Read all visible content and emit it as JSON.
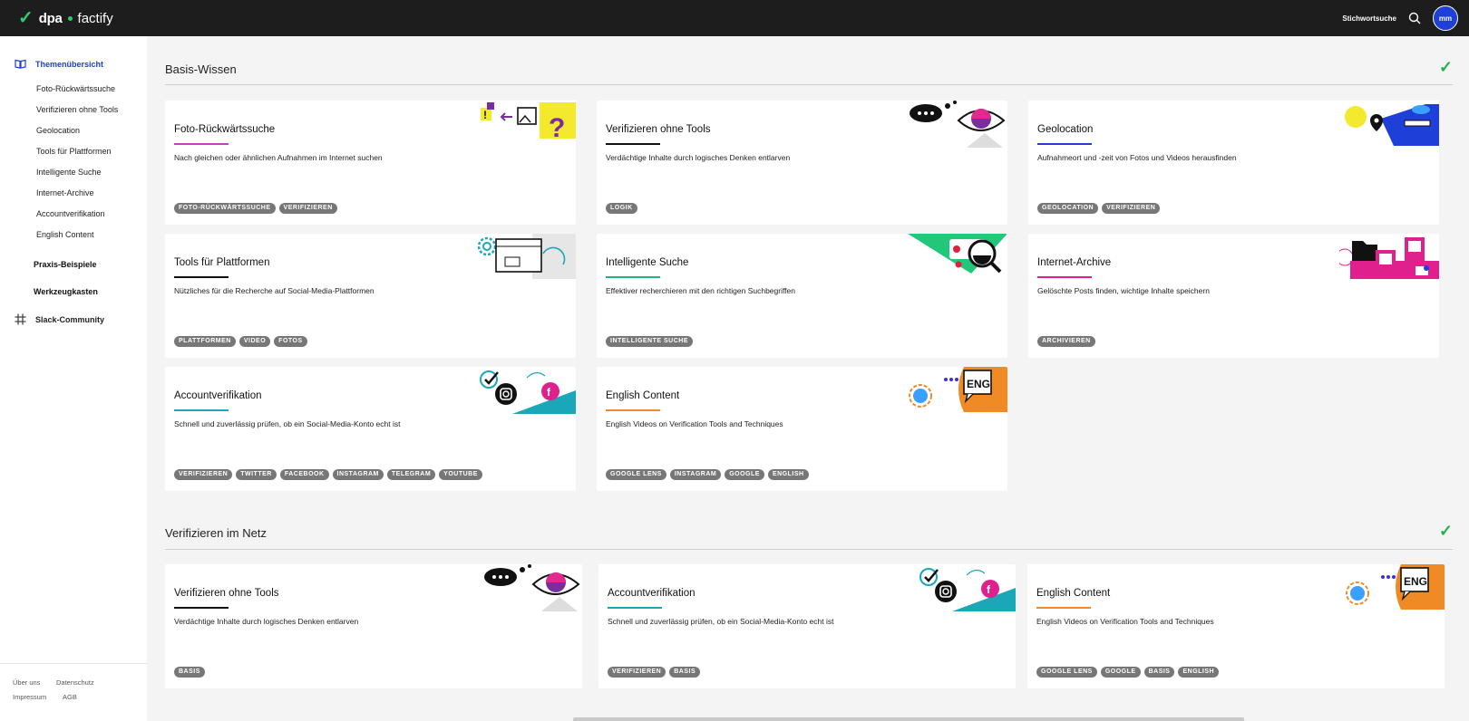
{
  "brand": {
    "name1": "dpa",
    "name2": "factify",
    "accent": "#2ecc71"
  },
  "topbar": {
    "keyword_label": "Stichwortsuche",
    "avatar_initials": "mm",
    "avatar_color": "#1e40d8"
  },
  "sidebar": {
    "items": [
      {
        "label": "Themenübersicht",
        "active": true,
        "icon": "book-icon"
      },
      {
        "label": "Praxis-Beispiele"
      },
      {
        "label": "Werkzeugkasten"
      },
      {
        "label": "Slack-Community",
        "icon": "slack-icon"
      }
    ],
    "subitems": [
      "Foto-Rückwärtssuche",
      "Verifizieren ohne Tools",
      "Geolocation",
      "Tools für Plattformen",
      "Intelligente Suche",
      "Internet-Archive",
      "Accountverifikation",
      "English Content"
    ],
    "footer": [
      "Über uns",
      "Datenschutz",
      "Impressum",
      "AGB"
    ]
  },
  "sections": [
    {
      "title": "Basis-Wissen",
      "cards": [
        {
          "title": "Foto-Rückwärtssuche",
          "desc": "Nach gleichen oder ähnlichen Aufnahmen im Internet suchen",
          "tags": [
            "FOTO-RÜCKWÄRTSSUCHE",
            "VERIFIZIEREN"
          ],
          "color": "#c040c0",
          "icon": "image-search-icon"
        },
        {
          "title": "Verifizieren ohne Tools",
          "desc": "Verdächtige Inhalte durch logisches Denken entlarven",
          "tags": [
            "LOGIK"
          ],
          "color": "#111111",
          "icon": "eye-icon"
        },
        {
          "title": "Geolocation",
          "desc": "Aufnahmeort und -zeit von Fotos und Videos herausfinden",
          "tags": [
            "GEOLOCATION",
            "VERIFIZIEREN"
          ],
          "color": "#1e40d8",
          "icon": "location-pin-icon"
        },
        {
          "title": "Tools für Plattformen",
          "desc": "Nützliches für die Recherche auf Social-Media-Plattformen",
          "tags": [
            "PLATTFORMEN",
            "VIDEO",
            "FOTOS"
          ],
          "color": "#111111",
          "icon": "gear-icon"
        },
        {
          "title": "Intelligente Suche",
          "desc": "Effektiver recherchieren mit den richtigen Suchbegriffen",
          "tags": [
            "INTELLIGENTE SUCHE"
          ],
          "color": "#22b37a",
          "icon": "magnifier-icon"
        },
        {
          "title": "Internet-Archive",
          "desc": "Gelöschte Posts finden, wichtige Inhalte speichern",
          "tags": [
            "ARCHIVIEREN"
          ],
          "color": "#e0208c",
          "icon": "folder-icon"
        },
        {
          "title": "Accountverifikation",
          "desc": "Schnell und zuverlässig prüfen, ob ein Social-Media-Konto echt ist",
          "tags": [
            "VERIFIZIEREN",
            "TWITTER",
            "FACEBOOK",
            "INSTAGRAM",
            "TELEGRAM",
            "YOUTUBE"
          ],
          "color": "#1aa7b8",
          "icon": "instagram-icon"
        },
        {
          "title": "English Content",
          "desc": "English Videos on Verification Tools and Techniques",
          "tags": [
            "GOOGLE LENS",
            "INSTAGRAM",
            "GOOGLE",
            "ENGLISH"
          ],
          "color": "#f08a24",
          "icon": "eng-speech-icon"
        }
      ]
    },
    {
      "title": "Verifizieren im Netz",
      "cards": [
        {
          "title": "Verifizieren ohne Tools",
          "desc": "Verdächtige Inhalte durch logisches Denken entlarven",
          "tags": [
            "BASIS"
          ],
          "color": "#111111",
          "icon": "eye-icon"
        },
        {
          "title": "Accountverifikation",
          "desc": "Schnell und zuverlässig prüfen, ob ein Social-Media-Konto echt ist",
          "tags": [
            "VERIFIZIEREN",
            "BASIS"
          ],
          "color": "#1aa7b8",
          "icon": "instagram-icon"
        },
        {
          "title": "English Content",
          "desc": "English Videos on Verification Tools and Techniques",
          "tags": [
            "GOOGLE LENS",
            "GOOGLE",
            "BASIS",
            "ENGLISH"
          ],
          "color": "#f08a24",
          "icon": "eng-speech-icon"
        }
      ]
    }
  ]
}
